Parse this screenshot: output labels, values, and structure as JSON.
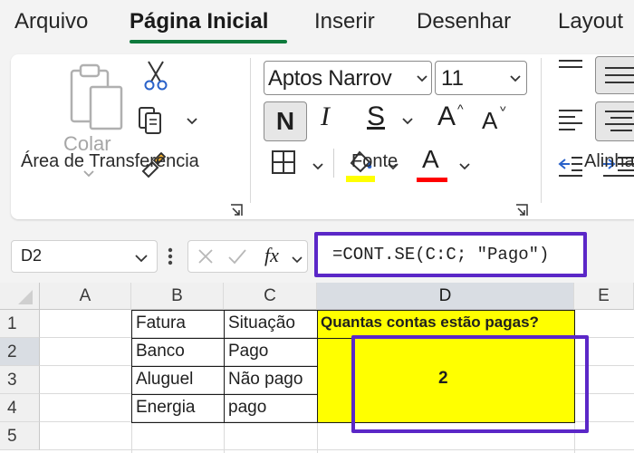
{
  "tabs": [
    "Arquivo",
    "Página Inicial",
    "Inserir",
    "Desenhar",
    "Layout"
  ],
  "active_tab": "Página Inicial",
  "ribbon": {
    "clipboard": {
      "paste_label": "Colar",
      "group_label": "Área de Transferência",
      "icons": [
        "clipboard-icon",
        "scissors-icon",
        "copy-icon",
        "format-painter-icon"
      ]
    },
    "font": {
      "font_name": "Aptos Narrow",
      "font_name_display": "Aptos Narrov",
      "font_size": "11",
      "bold_label": "N",
      "italic_label": "I",
      "underline_label": "S",
      "grow_label": "A",
      "shrink_label": "A",
      "font_color_label": "A",
      "group_label": "Fonte",
      "fill_color": "#ffff00",
      "font_color": "#ff0000"
    },
    "alignment": {
      "group_label": "Alinha"
    }
  },
  "formula_bar": {
    "name_box": "D2",
    "fx_label": "fx",
    "formula": "=CONT.SE(C:C; \"Pago\")"
  },
  "sheet": {
    "columns": [
      "A",
      "B",
      "C",
      "D",
      "E"
    ],
    "rows": [
      "1",
      "2",
      "3",
      "4",
      "5"
    ],
    "selected_column": "D",
    "selected_row": "2",
    "cells": {
      "B1": "Fatura",
      "C1": "Situação",
      "D1": "Quantas contas estão pagas?",
      "B2": "Banco",
      "C2": "Pago",
      "B3": "Aluguel",
      "C3": "Não pago",
      "B4": "Energia",
      "C4": "pago",
      "D2": "2"
    }
  },
  "colors": {
    "accent_tab": "#0e7a3c",
    "highlight_outline": "#5b27c7",
    "cell_fill": "#ffff00"
  }
}
